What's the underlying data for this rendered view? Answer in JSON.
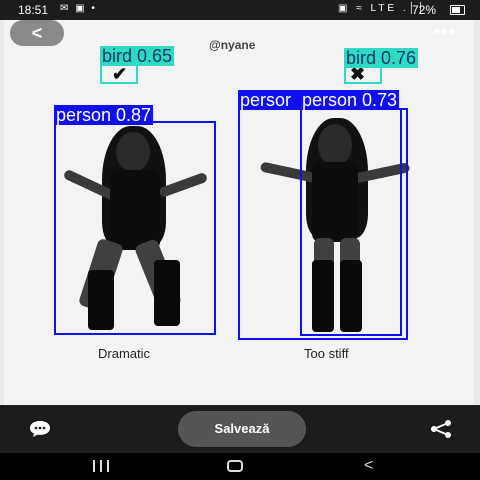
{
  "status_bar": {
    "time": "18:51",
    "left_icons": "✉ ▣ •",
    "right_icons": "▣ ≈ LTE .││",
    "battery_percent": "72%"
  },
  "content": {
    "back_glyph": "<",
    "more_glyph": "•••",
    "watermark": "@nyane",
    "captions": {
      "left": "Dramatic",
      "right": "Too stiff"
    },
    "marks": {
      "check": "✔",
      "x": "✖"
    },
    "detections": [
      {
        "label": "bird 0.65",
        "class": "bird"
      },
      {
        "label": "bird 0.76",
        "class": "bird"
      },
      {
        "label": "person 0.87",
        "class": "person"
      },
      {
        "label": "persor",
        "class": "person"
      },
      {
        "label": "person 0.73",
        "class": "person"
      }
    ]
  },
  "bottom_bar": {
    "save_label": "Salvează",
    "comment_icon": "comment-icon",
    "share_icon": "share-icon"
  },
  "nav_bar": {
    "back_glyph": "<"
  },
  "colors": {
    "person_box": "#1010ee",
    "bird_box": "#2fd9c4",
    "bar_bg": "#1c1c1c"
  }
}
